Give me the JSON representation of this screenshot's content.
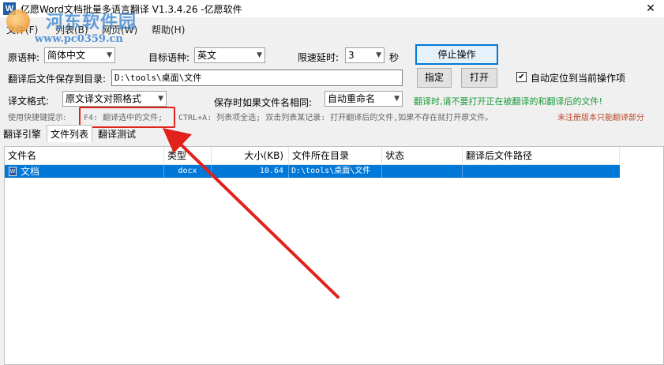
{
  "window": {
    "title": "亿愿Word文档批量多语言翻译 V1.3.4.26 -亿愿软件",
    "close_symbol": "✕",
    "app_icon_letter": "W"
  },
  "menu": [
    "文件(F)",
    "列表(B)",
    "网页(W)",
    "帮助(H)"
  ],
  "watermark": {
    "site_name": "河东软件园",
    "url": "www.pc0359.cn"
  },
  "settings": {
    "source_label": "原语种:",
    "source_value": "简体中文",
    "target_label": "目标语种:",
    "target_value": "英文",
    "delay_label": "限速延时:",
    "delay_value": "3",
    "delay_unit": "秒",
    "save_dir_label": "翻译后文件保存到目录:",
    "save_dir_value": "D:\\tools\\桌面\\文件",
    "format_label": "译文格式:",
    "format_value": "原文译文对照格式",
    "same_name_label": "保存时如果文件名相同:",
    "same_name_value": "自动重命名",
    "warning": "翻译时,请不要打开正在被翻译的和翻译后的文件!",
    "auto_locate_label": "自动定位到当前操作项",
    "auto_locate_checked": true
  },
  "buttons": {
    "stop": "停止操作",
    "specify": "指定",
    "open": "打开"
  },
  "hint": {
    "prefix": "使用快捷键提示:",
    "f4": "F4: 翻译选中的文件;",
    "rest": "CTRL+A: 列表项全选; 双击列表某记录: 打开翻译后的文件,如果不存在就打开原文件。",
    "unregistered": "未注册版本只能翻译部分"
  },
  "tabs": [
    "翻译引擎",
    "文件列表",
    "翻译测试"
  ],
  "table": {
    "columns": [
      "文件名",
      "类型",
      "大小(KB)",
      "文件所在目录",
      "状态",
      "翻译后文件路径"
    ],
    "rows": [
      {
        "name": "文档",
        "type": "docx",
        "size": "10.64",
        "dir": "D:\\tools\\桌面\\文件",
        "status": "",
        "out_path": ""
      }
    ]
  },
  "colors": {
    "accent": "#0078d7",
    "warning_green": "#1a9a3a",
    "annotation_red": "#e2211c",
    "unregistered_text": "#c0492b"
  },
  "icons": {
    "app": "word-app-icon",
    "file": "word-document-icon",
    "dropdown": "chevron-down-icon",
    "checkbox": "checkmark-icon"
  }
}
